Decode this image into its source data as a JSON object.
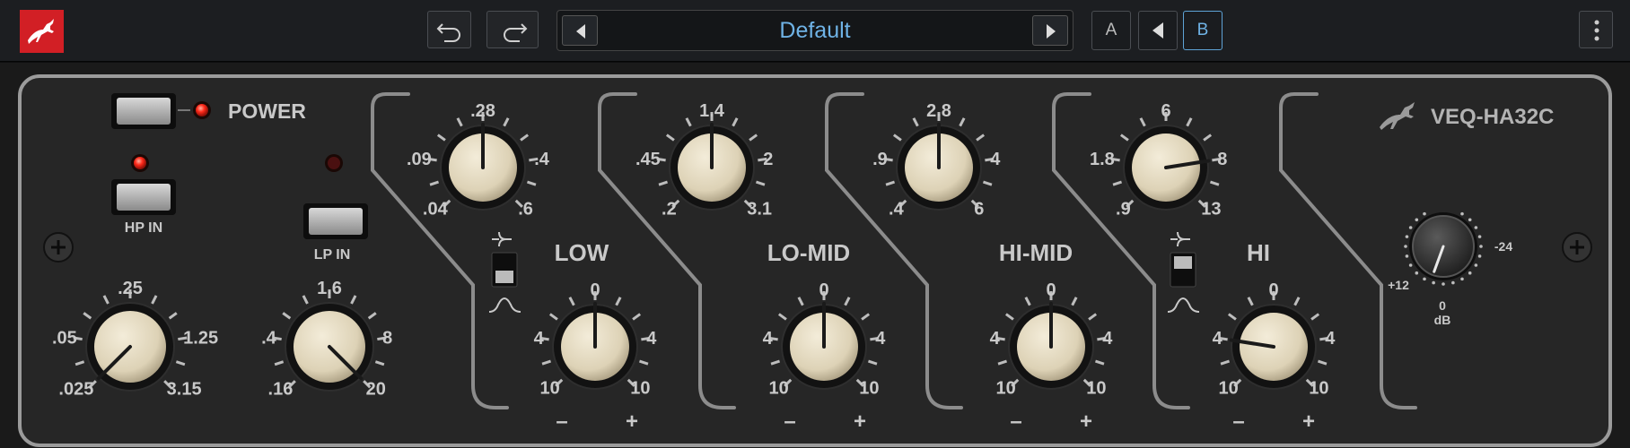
{
  "topbar": {
    "preset_name": "Default",
    "ab": {
      "a_label": "A",
      "b_label": "B",
      "active": "B"
    },
    "icons": [
      "antelope-logo-icon",
      "undo-icon",
      "redo-icon",
      "chevron-left-icon",
      "chevron-right-icon",
      "copy-arrow-icon",
      "more-vertical-icon"
    ]
  },
  "plugin": {
    "name": "VEQ-HA32C",
    "power_label": "POWER",
    "hp_label": "HP IN",
    "lp_label": "LP IN",
    "band_titles": {
      "low": "LOW",
      "lo_mid": "LO-MID",
      "hi_mid": "HI-MID",
      "hi": "HI"
    },
    "plus_sign": "+",
    "minus_sign": "–",
    "leds": {
      "power": true,
      "hp": true,
      "lp": false
    },
    "colors": {
      "led_on": "#ff2a1a",
      "led_off": "#4a1010",
      "panel": "#232323",
      "knob_cap": "#e3d9c0",
      "label": "#c9c9c9",
      "accent": "#5ea3d6"
    }
  },
  "knobs": {
    "hp": {
      "labels": [
        ".025",
        ".05",
        ".25",
        "1.25",
        "3.15"
      ],
      "value": ".025"
    },
    "lp": {
      "labels": [
        ".16",
        ".4",
        "1.6",
        "8",
        "20"
      ],
      "value": "20"
    },
    "low_freq": {
      "labels": [
        ".04",
        ".09",
        ".28",
        ".4",
        ".6"
      ],
      "value": ".28"
    },
    "lo_mid_freq": {
      "labels": [
        ".2",
        ".45",
        "1.4",
        "2",
        "3.1"
      ],
      "value": "1.4"
    },
    "hi_mid_freq": {
      "labels": [
        ".4",
        ".9",
        "2.8",
        "4",
        "6"
      ],
      "value": "2.8"
    },
    "hi_freq": {
      "labels": [
        ".9",
        "1.8",
        "6",
        "8",
        "13"
      ],
      "value": "8"
    },
    "low_gain": {
      "labels": [
        "10",
        "4",
        "0",
        "4",
        "10"
      ],
      "value": "0"
    },
    "lo_mid_gain": {
      "labels": [
        "10",
        "4",
        "0",
        "4",
        "10"
      ],
      "value": "0"
    },
    "hi_mid_gain": {
      "labels": [
        "10",
        "4",
        "0",
        "4",
        "10"
      ],
      "value": "0"
    },
    "hi_gain": {
      "labels": [
        "10",
        "4",
        "0",
        "4",
        "10"
      ],
      "value": "4"
    },
    "output": {
      "labels": [
        "+12",
        "0",
        "-24"
      ],
      "unit": "dB",
      "value": "0"
    }
  }
}
